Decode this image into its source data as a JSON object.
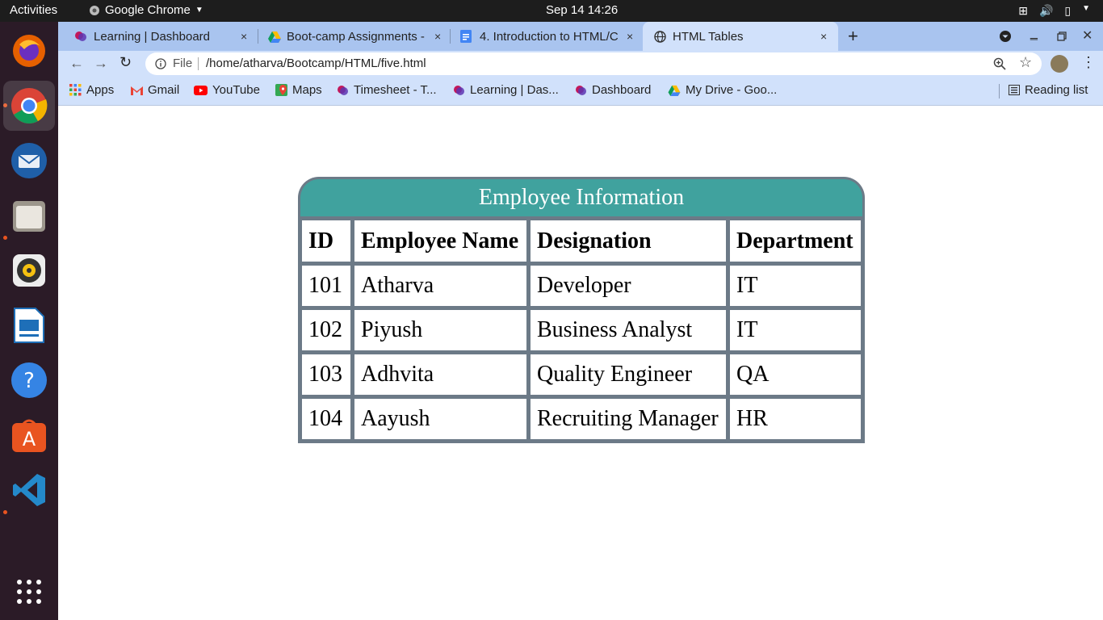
{
  "system": {
    "activities": "Activities",
    "app_name": "Google Chrome",
    "clock": "Sep 14  14:26"
  },
  "tabs": [
    {
      "title": "Learning | Dashboard",
      "close": "×"
    },
    {
      "title": "Boot-camp Assignments -",
      "close": "×"
    },
    {
      "title": "4. Introduction to HTML/C",
      "close": "×"
    },
    {
      "title": "HTML Tables",
      "close": "×"
    }
  ],
  "address_bar": {
    "scheme_label": "File",
    "url": "/home/atharva/Bootcamp/HTML/five.html"
  },
  "bookmarks": [
    "Apps",
    "Gmail",
    "YouTube",
    "Maps",
    "Timesheet - T...",
    "Learning | Das...",
    "Dashboard",
    "My Drive - Goo..."
  ],
  "reading_list": "Reading list",
  "table": {
    "caption": "Employee Information",
    "headers": [
      "ID",
      "Employee Name",
      "Designation",
      "Department"
    ],
    "rows": [
      [
        "101",
        "Atharva",
        "Developer",
        "IT"
      ],
      [
        "102",
        "Piyush",
        "Business Analyst",
        "IT"
      ],
      [
        "103",
        "Adhvita",
        "Quality Engineer",
        "QA"
      ],
      [
        "104",
        "Aayush",
        "Recruiting Manager",
        "HR"
      ]
    ]
  },
  "colors": {
    "caption_bg": "#40a29e",
    "table_border": "#6c7a87",
    "tab_strip": "#a9c4ef",
    "toolbar": "#d1e1fb",
    "dock": "#2b1b27"
  }
}
